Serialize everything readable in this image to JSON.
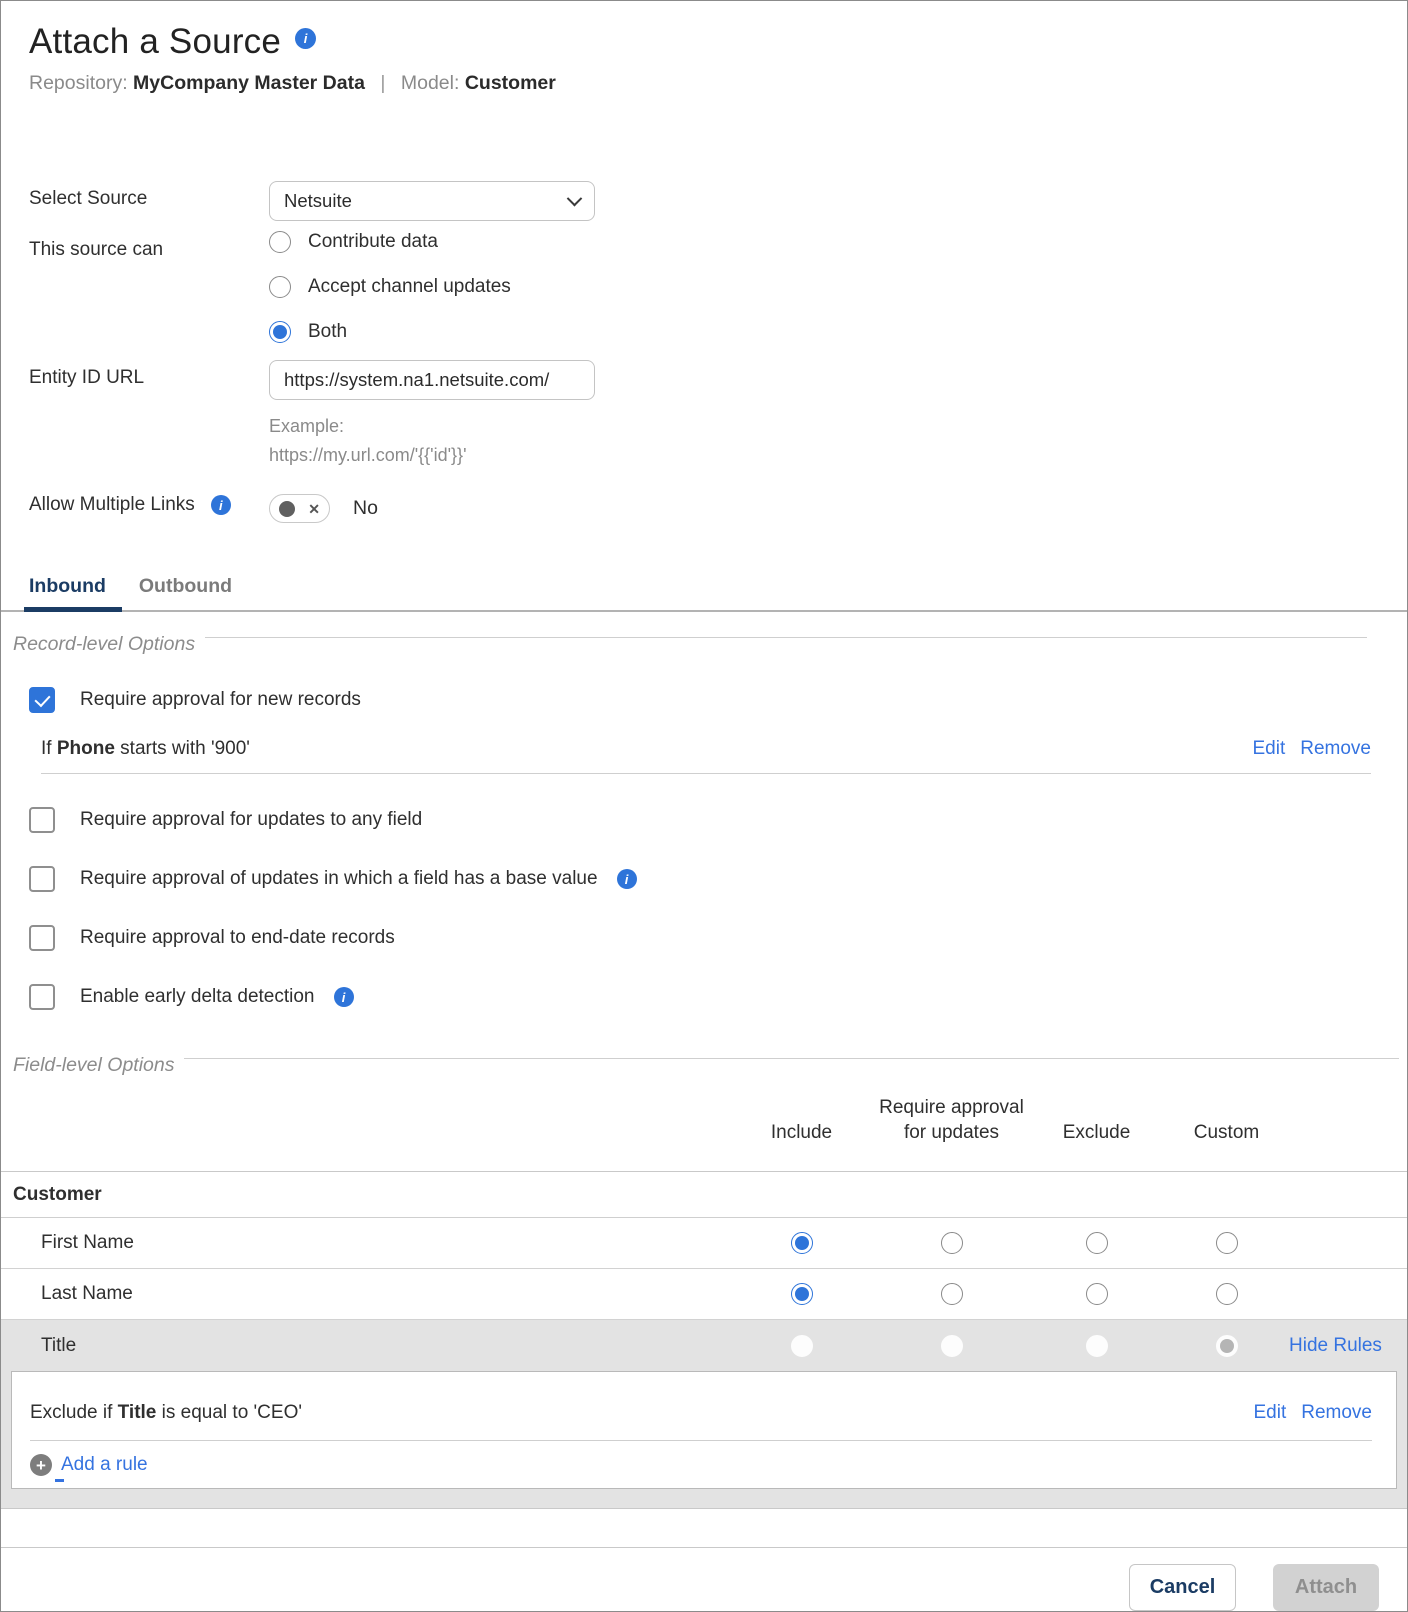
{
  "icons": {
    "info": "i",
    "close": "✕",
    "plus": "+"
  },
  "colors": {
    "accent_blue": "#2e74d9",
    "link_blue": "#3573e0",
    "navy": "#1b3c64",
    "highlight_gray": "#e3e3e3"
  },
  "header": {
    "title": "Attach a Source",
    "repository_label": "Repository:",
    "repository_value": "MyCompany Master Data",
    "separator": "|",
    "model_label": "Model:",
    "model_value": "Customer"
  },
  "form": {
    "select_source": {
      "label": "Select Source",
      "value": "Netsuite"
    },
    "source_can": {
      "label": "This source can",
      "options": [
        {
          "label": "Contribute data",
          "selected": false
        },
        {
          "label": "Accept channel updates",
          "selected": false
        },
        {
          "label": "Both",
          "selected": true
        }
      ]
    },
    "entity_id_url": {
      "label": "Entity ID URL",
      "value": "https://system.na1.netsuite.com/",
      "example_label": "Example:",
      "example_value": "https://my.url.com/'{{'id'}}'"
    },
    "allow_multiple_links": {
      "label": "Allow Multiple Links",
      "state_text": "No",
      "enabled": false
    }
  },
  "tabs": [
    {
      "label": "Inbound",
      "active": true
    },
    {
      "label": "Outbound",
      "active": false
    }
  ],
  "record_options": {
    "legend": "Record-level Options",
    "checkboxes": [
      {
        "label": "Require approval for new records",
        "checked": true,
        "info": false
      },
      {
        "label": "Require approval for updates to any field",
        "checked": false,
        "info": false
      },
      {
        "label": "Require approval of updates in which a field has a base value",
        "checked": false,
        "info": true
      },
      {
        "label": "Require approval to end-date records",
        "checked": false,
        "info": false
      },
      {
        "label": "Enable early delta detection",
        "checked": false,
        "info": true
      }
    ],
    "rule": {
      "prefix": "If ",
      "field": "Phone",
      "suffix": " starts with '900'",
      "edit": "Edit",
      "remove": "Remove"
    }
  },
  "field_options": {
    "legend": "Field-level Options",
    "columns": [
      "Include",
      "Require approval for updates",
      "Exclude",
      "Custom"
    ],
    "group": "Customer",
    "rows": [
      {
        "name": "First Name",
        "selected": "include",
        "highlighted": false
      },
      {
        "name": "Last Name",
        "selected": "include",
        "highlighted": false
      },
      {
        "name": "Title",
        "selected": "custom",
        "highlighted": true,
        "link": "Hide Rules"
      }
    ],
    "rule": {
      "prefix": "Exclude if ",
      "field": "Title",
      "suffix": " is equal to 'CEO'",
      "edit": "Edit",
      "remove": "Remove"
    },
    "add_rule": "Add a rule"
  },
  "footer": {
    "cancel": "Cancel",
    "attach": "Attach"
  }
}
